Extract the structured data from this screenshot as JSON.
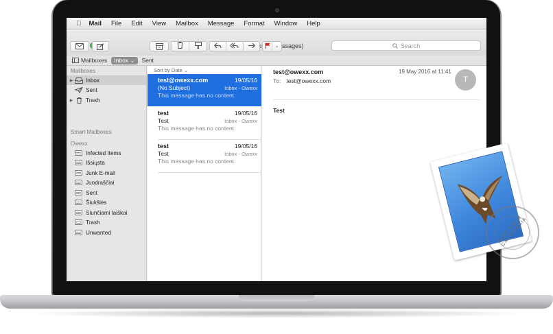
{
  "menubar": {
    "items": [
      "Mail",
      "File",
      "Edit",
      "View",
      "Mailbox",
      "Message",
      "Format",
      "Window",
      "Help"
    ]
  },
  "window": {
    "title": "Inbox (3 messages)"
  },
  "search": {
    "placeholder": "Search"
  },
  "favorites": {
    "mailboxes_label": "Mailboxes",
    "inbox_label": "Inbox",
    "sent_label": "Sent"
  },
  "sidebar": {
    "mailboxes_header": "Mailboxes",
    "mailboxes": [
      {
        "label": "Inbox",
        "icon": "inbox-icon",
        "selected": true
      },
      {
        "label": "Sent",
        "icon": "paper-plane-icon"
      },
      {
        "label": "Trash",
        "icon": "trash-icon"
      }
    ],
    "smart_header": "Smart Mailboxes",
    "account_header": "Owexx",
    "folders": [
      "Infected Items",
      "Išsiųsta",
      "Junk E-mail",
      "Juodraščiai",
      "Sent",
      "Šiukšlės",
      "Siunčiami laiškai",
      "Trash",
      "Unwanted"
    ]
  },
  "message_list": {
    "sort_label": "Sort by Date",
    "messages": [
      {
        "from": "test@owexx.com",
        "date": "19/05/16",
        "subject": "(No Subject)",
        "mailbox": "Inbox - Owexx",
        "preview": "This message has no content.",
        "selected": true
      },
      {
        "from": "test",
        "date": "19/05/16",
        "subject": "Test",
        "mailbox": "Inbox - Owexx",
        "preview": "This message has no content."
      },
      {
        "from": "test",
        "date": "19/05/16",
        "subject": "Test",
        "mailbox": "Inbox - Owexx",
        "preview": "This message has no content."
      }
    ]
  },
  "reader": {
    "from": "test@owexx.com",
    "date": "19 May 2016 at 11:41",
    "to_label": "To:",
    "to": "test@owexx.com",
    "avatar_initial": "T",
    "body": "Test"
  },
  "stamp": {
    "postmark_text": "SENT FROM CALIFORNIA"
  },
  "colors": {
    "selection": "#1f6fe0",
    "flag": "#e0251b"
  }
}
